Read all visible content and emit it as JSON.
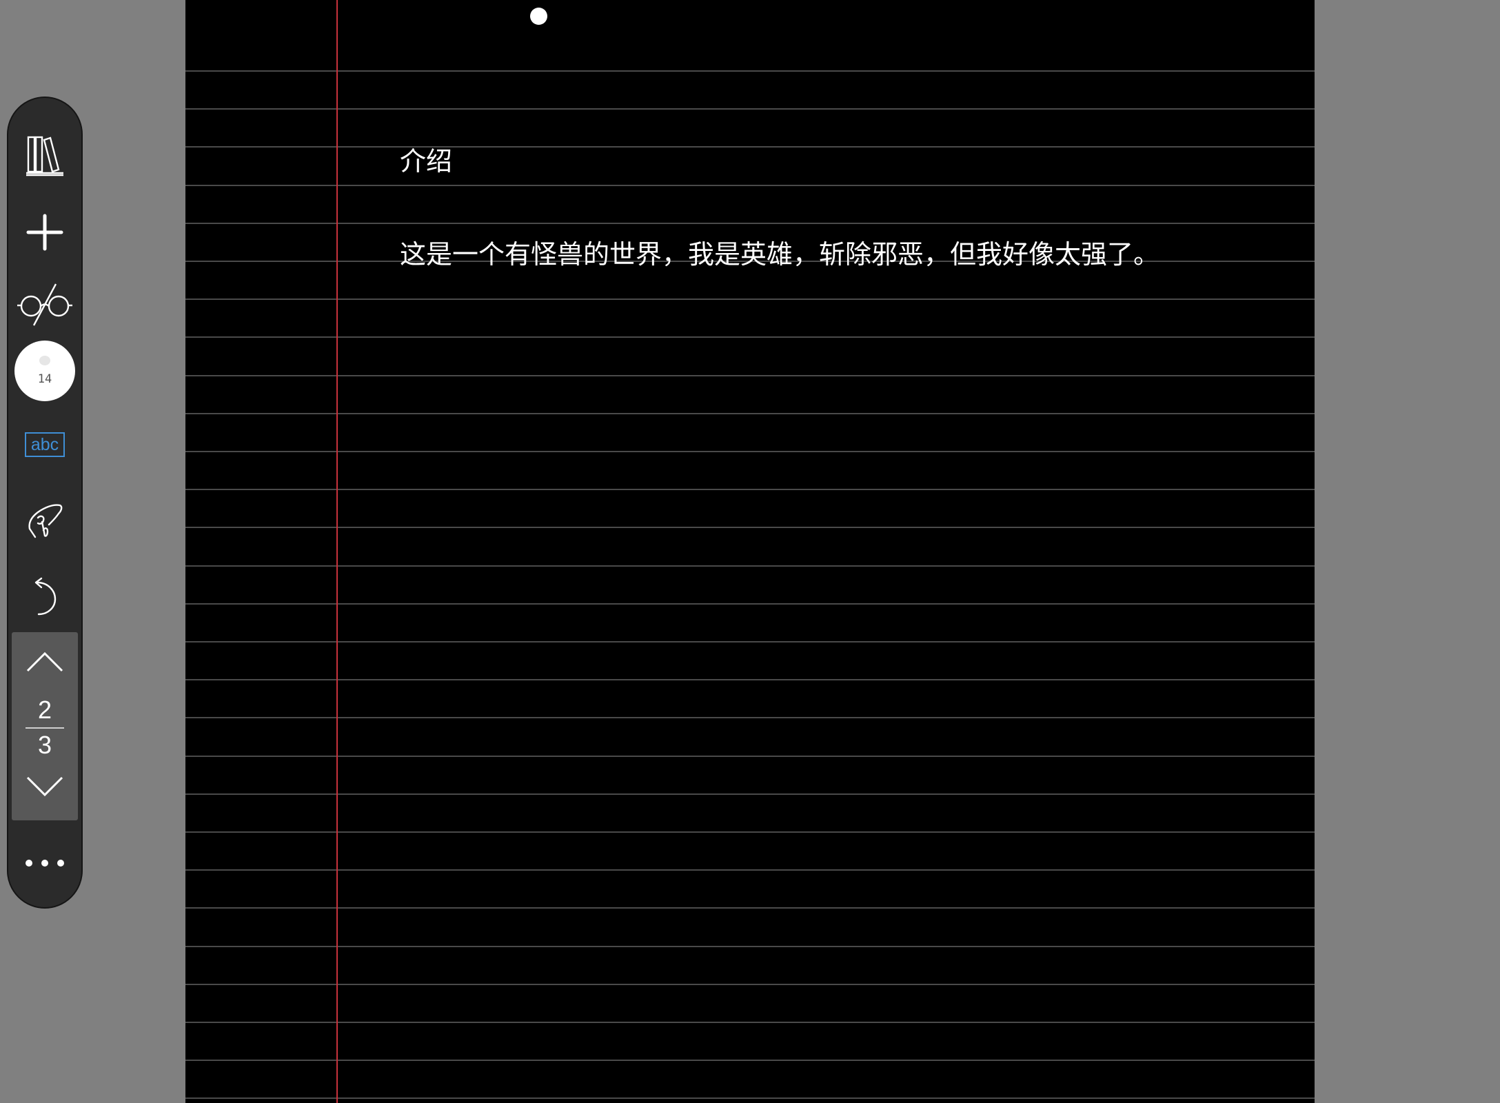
{
  "note": {
    "title": "介绍",
    "body": "这是一个有怪兽的世界，我是英雄，斩除邪恶，但我好像太强了。"
  },
  "toolbar": {
    "items": [
      {
        "name": "library",
        "icon": "library-books-icon"
      },
      {
        "name": "add",
        "icon": "plus-icon"
      },
      {
        "name": "reading-mode",
        "icon": "glasses-icon"
      },
      {
        "name": "text-style",
        "label": "abc"
      },
      {
        "name": "gesture",
        "icon": "hand-pointer-icon"
      },
      {
        "name": "undo",
        "icon": "undo-arrow-icon"
      }
    ],
    "font_size": "14",
    "pager": {
      "current_page": "2",
      "total_pages": "3"
    },
    "more_icon": "more-dots-icon"
  },
  "colors": {
    "paper": "#000000",
    "rule_line": "#4a4a4a",
    "margin_line": "#c8323c",
    "toolbar_bg": "#2b2b2b",
    "accent": "#3f8fd6",
    "background": "#808080"
  }
}
